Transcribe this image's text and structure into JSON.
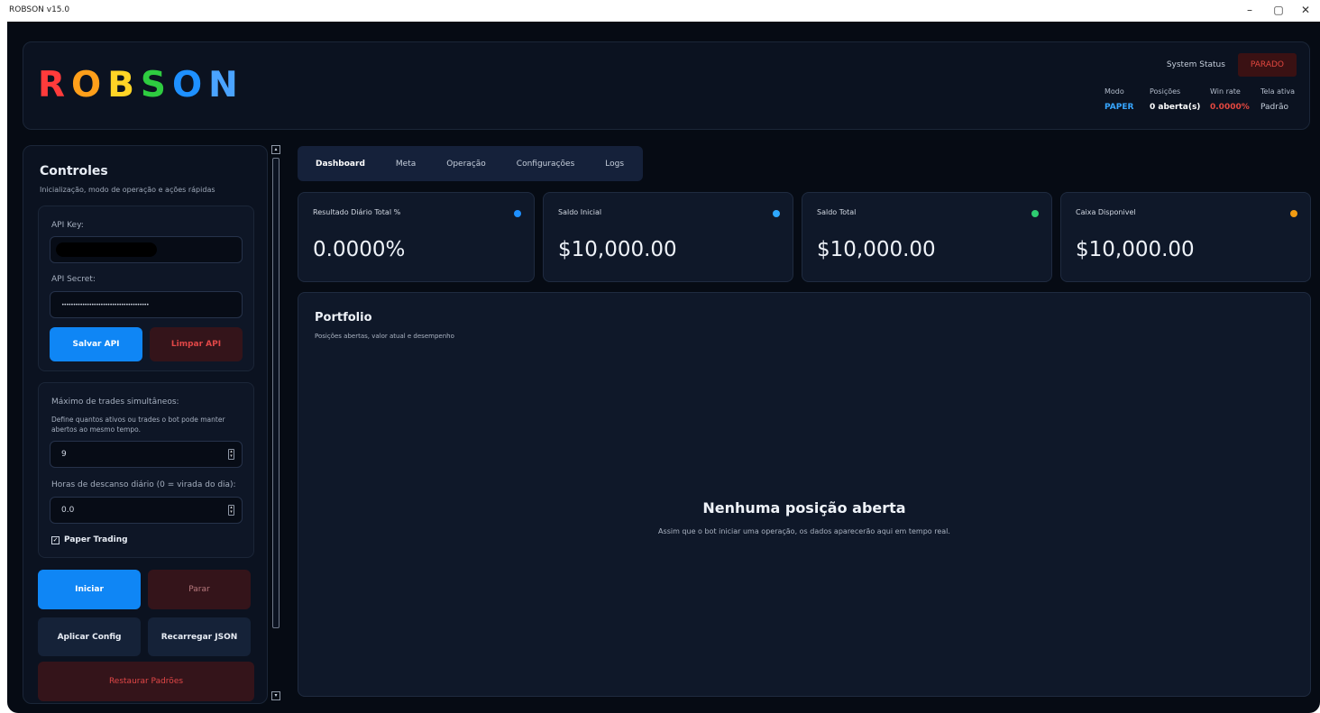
{
  "window": {
    "title": "ROBSON v15.0",
    "minimize": "–",
    "restore": "▢",
    "close": "✕"
  },
  "header": {
    "logo_letters": [
      "R",
      "O",
      "B",
      "S",
      "O",
      "N"
    ],
    "logo_colors": [
      "#ff3b3b",
      "#ff9f1a",
      "#ffd426",
      "#2ecc40",
      "#1e90ff",
      "#4aa3ff"
    ],
    "system_status_label": "System Status",
    "system_status_value": "PARADO",
    "stats": [
      {
        "label": "Modo",
        "value": "PAPER",
        "color": "#37a6ff"
      },
      {
        "label": "Posições",
        "value": "0 aberta(s)",
        "color": "#ffffff"
      },
      {
        "label": "Win rate",
        "value": "0.0000%",
        "color": "#e2473f"
      },
      {
        "label": "Tela ativa",
        "value": "Padrão",
        "color": "#c6cfdc"
      }
    ]
  },
  "sidebar": {
    "title": "Controles",
    "subtitle": "Inicialização, modo de operação e ações rápidas",
    "api_key_label": "API Key:",
    "api_secret_label": "API Secret:",
    "api_secret_value": "••••••••••••••••••••••••••••••••••••••",
    "save_api": "Salvar API",
    "clear_api": "Limpar API",
    "max_trades_label": "Máximo de trades simultâneos:",
    "max_trades_help": "Define quantos ativos ou trades o bot pode manter abertos ao mesmo tempo.",
    "max_trades_value": "9",
    "rest_hours_label": "Horas de descanso diário (0 = virada do dia):",
    "rest_hours_value": "0.0",
    "paper_trading_label": "Paper Trading",
    "paper_trading_checked": "✓",
    "start": "Iniciar",
    "stop": "Parar",
    "apply_config": "Aplicar Config",
    "reload_json": "Recarregar JSON",
    "restore_defaults": "Restaurar Padrões"
  },
  "tabs": [
    "Dashboard",
    "Meta",
    "Operação",
    "Configurações",
    "Logs"
  ],
  "metrics": [
    {
      "label": "Resultado Diário Total %",
      "value": "0.0000%",
      "dot_color": "#1e90ff"
    },
    {
      "label": "Saldo Inicial",
      "value": "$10,000.00",
      "dot_color": "#2ea8ff"
    },
    {
      "label": "Saldo Total",
      "value": "$10,000.00",
      "dot_color": "#2ecc71"
    },
    {
      "label": "Caixa Disponivel",
      "value": "$10,000.00",
      "dot_color": "#f39c12"
    }
  ],
  "portfolio": {
    "title": "Portfolio",
    "subtitle": "Posições abertas, valor atual e desempenho",
    "empty_title": "Nenhuma posição aberta",
    "empty_subtitle": "Assim que o bot iniciar uma operação, os dados aparecerão aqui em tempo real."
  }
}
